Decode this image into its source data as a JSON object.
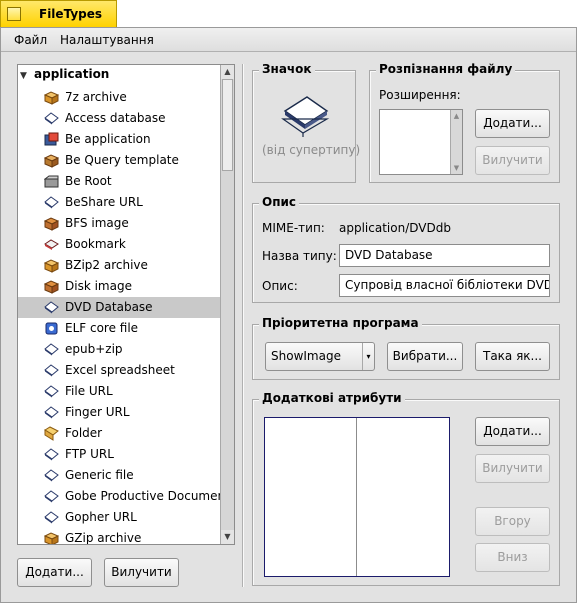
{
  "window": {
    "title": "FileTypes"
  },
  "menu": {
    "file": "Файл",
    "settings": "Налаштування"
  },
  "list": {
    "group": "application",
    "items": [
      {
        "label": "7z archive",
        "icon": "archive-icon"
      },
      {
        "label": "Access database",
        "icon": "generic-icon"
      },
      {
        "label": "Be application",
        "icon": "app-icon"
      },
      {
        "label": "Be Query template",
        "icon": "query-icon"
      },
      {
        "label": "Be Root",
        "icon": "disk-icon"
      },
      {
        "label": "BeShare URL",
        "icon": "generic-icon"
      },
      {
        "label": "BFS image",
        "icon": "image-icon"
      },
      {
        "label": "Bookmark",
        "icon": "bookmark-icon"
      },
      {
        "label": "BZip2 archive",
        "icon": "archive-icon"
      },
      {
        "label": "Disk image",
        "icon": "image-icon"
      },
      {
        "label": "DVD Database",
        "icon": "generic-icon"
      },
      {
        "label": "ELF core file",
        "icon": "elf-icon"
      },
      {
        "label": "epub+zip",
        "icon": "generic-icon"
      },
      {
        "label": "Excel spreadsheet",
        "icon": "generic-icon"
      },
      {
        "label": "File URL",
        "icon": "generic-icon"
      },
      {
        "label": "Finger URL",
        "icon": "generic-icon"
      },
      {
        "label": "Folder",
        "icon": "folder-icon"
      },
      {
        "label": "FTP URL",
        "icon": "generic-icon"
      },
      {
        "label": "Generic file",
        "icon": "generic-icon"
      },
      {
        "label": "Gobe Productive Document",
        "icon": "generic-icon"
      },
      {
        "label": "Gopher URL",
        "icon": "generic-icon"
      },
      {
        "label": "GZip archive",
        "icon": "archive-icon"
      }
    ],
    "selected_index": 10,
    "add_button": "Додати...",
    "remove_button": "Вилучити"
  },
  "icon_group": {
    "title": "Значок",
    "caption": "(від супертипу)"
  },
  "recognition": {
    "title": "Розпізнання файлу",
    "extensions_label": "Розширення:",
    "add_button": "Додати...",
    "remove_button": "Вилучити"
  },
  "description": {
    "title": "Опис",
    "mime_label": "MIME-тип:",
    "mime_value": "application/DVDdb",
    "type_name_label": "Назва типу:",
    "type_name_value": "DVD Database",
    "desc_label": "Опис:",
    "desc_value": "Супровід власної бібліотеки DVD-дисків"
  },
  "preferred": {
    "title": "Пріоритетна програма",
    "app_value": "ShowImage",
    "select_button": "Вибрати...",
    "same_as_button": "Така як..."
  },
  "attributes": {
    "title": "Додаткові атрибути",
    "add_button": "Додати...",
    "remove_button": "Вилучити",
    "up_button": "Вгору",
    "down_button": "Вниз"
  },
  "colors": {
    "accent": "#ffd200",
    "selection": "#c9c9c9",
    "panel": "#e2e2e2"
  }
}
